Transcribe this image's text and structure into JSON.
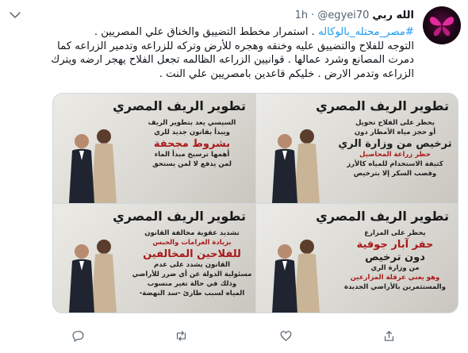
{
  "tweet": {
    "author_name": "الله ربي",
    "handle": "@egyei70",
    "separator": "·",
    "time": "1h",
    "hashtag": "#مصر_محتله_بالوكاله",
    "lines": [
      " . استمرار مخطط التضييق والخناق علي المصريين .",
      "التوجه للفلاح والتضييق عليه وخنقه وهجره للأرض وتركه للزراعه وتدمير الزراعه كما",
      "دمرت المصانع وشرد عمالها . قوانيين الزراعه الظالمه تجعل الفلاح يهجر ارضه ويترك",
      "الزراعه وتدمر الارض . خليكم قاعدين بامصريين علي النت ."
    ]
  },
  "media": {
    "panels": [
      {
        "title": "تطوير الريف المصري",
        "lines": [
          {
            "text": "يحظر على الفلاح تحويل",
            "style": "normal"
          },
          {
            "text": "أو حجز مياه الأمطار دون",
            "style": "normal"
          },
          {
            "text": "ترخيص من وزارة الري",
            "style": "big"
          },
          {
            "text": "حظر زراعة المحاصيل",
            "style": "red"
          },
          {
            "text": "كثيفة الاستخدام للمياه كالأرز",
            "style": "normal"
          },
          {
            "text": "وقصب السكر إلا بترخيص",
            "style": "normal"
          }
        ]
      },
      {
        "title": "تطوير الريف المصري",
        "lines": [
          {
            "text": "السيسي يعد بتطوير الريف",
            "style": "normal"
          },
          {
            "text": "ويبدأ بقانون جديد للري",
            "style": "normal"
          },
          {
            "text": "بشروط مجحفة",
            "style": "bigred"
          },
          {
            "text": "أهمها ترسيخ مبدأ الماء",
            "style": "normal"
          },
          {
            "text": "لمن يدفع لا لمن يستحق",
            "style": "normal"
          }
        ]
      },
      {
        "title": "تطوير الريف المصري",
        "lines": [
          {
            "text": "يحظر على المزارع",
            "style": "normal"
          },
          {
            "text": "حفر آبار جوفية",
            "style": "bigred"
          },
          {
            "text": "دون ترخيص",
            "style": "big"
          },
          {
            "text": "من وزارة الري",
            "style": "normal"
          },
          {
            "text": "وهو يعني عرقلة المزارعين",
            "style": "red"
          },
          {
            "text": "والمستثمرين بالأراضي الجديدة",
            "style": "normal"
          }
        ]
      },
      {
        "title": "تطوير الريف المصري",
        "lines": [
          {
            "text": "تشديد عقوبة مخالفة القانون",
            "style": "normal"
          },
          {
            "text": "بزيادة الغرامات والحبس",
            "style": "red"
          },
          {
            "text": "للفلاحين المخالفين",
            "style": "bigred"
          },
          {
            "text": "القانون يشدد على عدم",
            "style": "normal"
          },
          {
            "text": "مسئولية الدولة عن أي ضرر للأراضي",
            "style": "normal"
          },
          {
            "text": "وذلك في حالة تغير منسوب",
            "style": "normal"
          },
          {
            "text": "المياه لسبب طارئ -سد النهضة-",
            "style": "normal"
          }
        ]
      }
    ]
  },
  "actions": {
    "reply_count": "",
    "retweet_count": "",
    "like_count": "",
    "share_label": ""
  },
  "colors": {
    "accent": "#1d9bf0",
    "secondary_text": "#536471",
    "red_text": "#a81a1a"
  },
  "icons": [
    "butterfly-avatar",
    "chevron-down-icon",
    "reply-icon",
    "retweet-icon",
    "like-icon",
    "share-icon"
  ]
}
